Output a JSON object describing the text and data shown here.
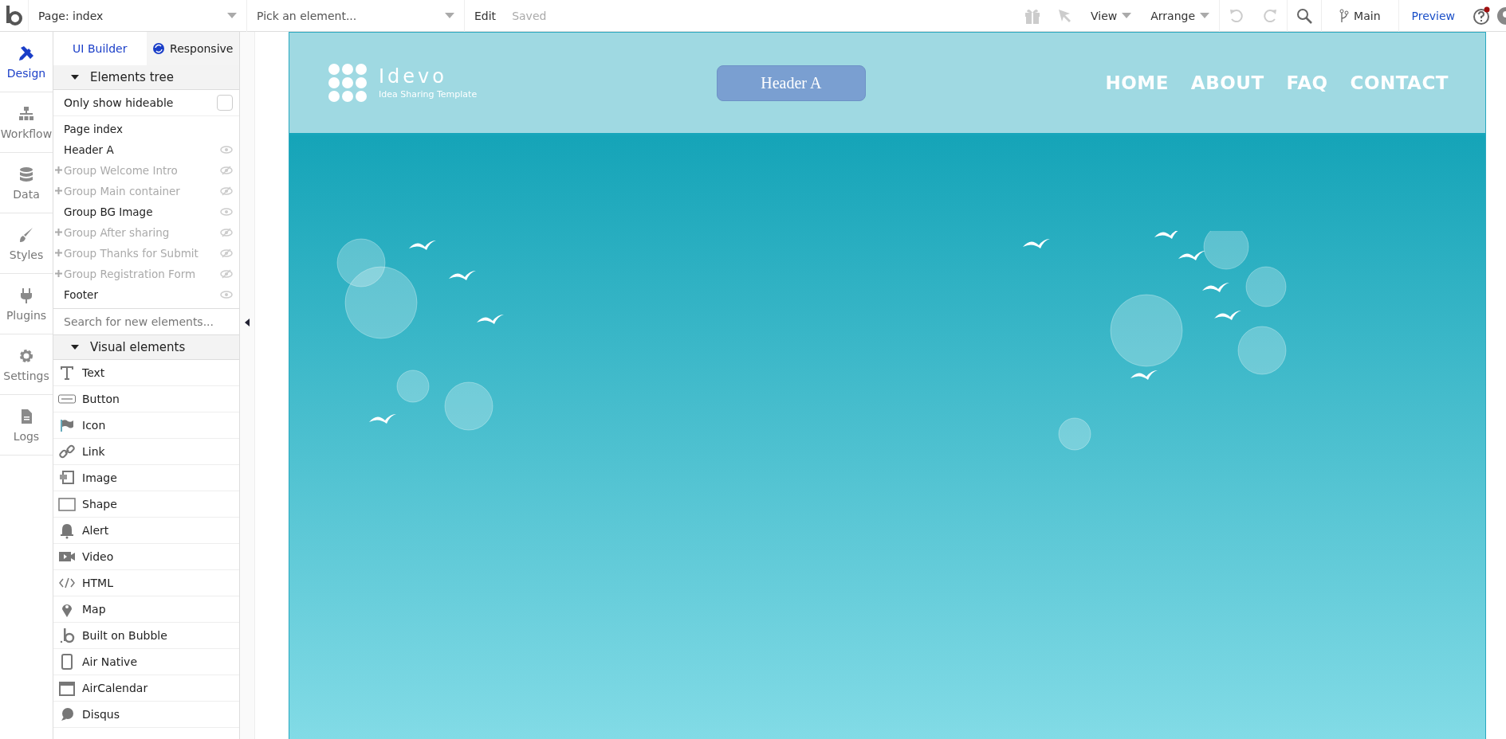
{
  "topbar": {
    "page_selector": "Page: index",
    "element_picker": "Pick an element...",
    "edit": "Edit",
    "save_status": "Saved",
    "view": "View",
    "arrange": "Arrange",
    "branch": "Main",
    "preview": "Preview"
  },
  "nav": [
    {
      "label": "Design",
      "selected": true
    },
    {
      "label": "Workflow",
      "selected": false
    },
    {
      "label": "Data",
      "selected": false
    },
    {
      "label": "Styles",
      "selected": false
    },
    {
      "label": "Plugins",
      "selected": false
    },
    {
      "label": "Settings",
      "selected": false
    },
    {
      "label": "Logs",
      "selected": false
    }
  ],
  "panel": {
    "tabs": [
      {
        "label": "UI Builder",
        "selected": true
      },
      {
        "label": "Responsive",
        "selected": false
      }
    ],
    "tree_section": {
      "label": "Elements tree",
      "expanded": true
    },
    "filter": {
      "label": "Only show hideable",
      "checked": false
    },
    "tree": [
      {
        "label": "Page index",
        "kind": "page"
      },
      {
        "label": "Header A",
        "kind": "element",
        "hidden": false,
        "has_children": false
      },
      {
        "label": "Group Welcome Intro",
        "kind": "element",
        "hidden": true,
        "has_children": true
      },
      {
        "label": "Group Main container",
        "kind": "element",
        "hidden": true,
        "has_children": true
      },
      {
        "label": "Group BG Image",
        "kind": "element",
        "hidden": false,
        "has_children": false
      },
      {
        "label": "Group After sharing",
        "kind": "element",
        "hidden": true,
        "has_children": true
      },
      {
        "label": "Group Thanks for Submit",
        "kind": "element",
        "hidden": true,
        "has_children": true
      },
      {
        "label": "Group Registration Form",
        "kind": "element",
        "hidden": true,
        "has_children": true
      },
      {
        "label": "Footer",
        "kind": "element",
        "hidden": false,
        "has_children": false
      }
    ],
    "search": {
      "placeholder": "Search for new elements..."
    },
    "visual_section": {
      "label": "Visual elements",
      "expanded": true
    },
    "elements": [
      {
        "label": "Text"
      },
      {
        "label": "Button"
      },
      {
        "label": "Icon"
      },
      {
        "label": "Link"
      },
      {
        "label": "Image"
      },
      {
        "label": "Shape"
      },
      {
        "label": "Alert"
      },
      {
        "label": "Video"
      },
      {
        "label": "HTML"
      },
      {
        "label": "Map"
      },
      {
        "label": "Built on Bubble"
      },
      {
        "label": "Air Native"
      },
      {
        "label": "AirCalendar"
      },
      {
        "label": "Disqus"
      }
    ]
  },
  "canvas": {
    "header": {
      "logo": "Idevo",
      "tagline": "Idea Sharing Template",
      "button": "Header A",
      "menu": [
        "HOME",
        "ABOUT",
        "FAQ",
        "CONTACT"
      ]
    }
  }
}
